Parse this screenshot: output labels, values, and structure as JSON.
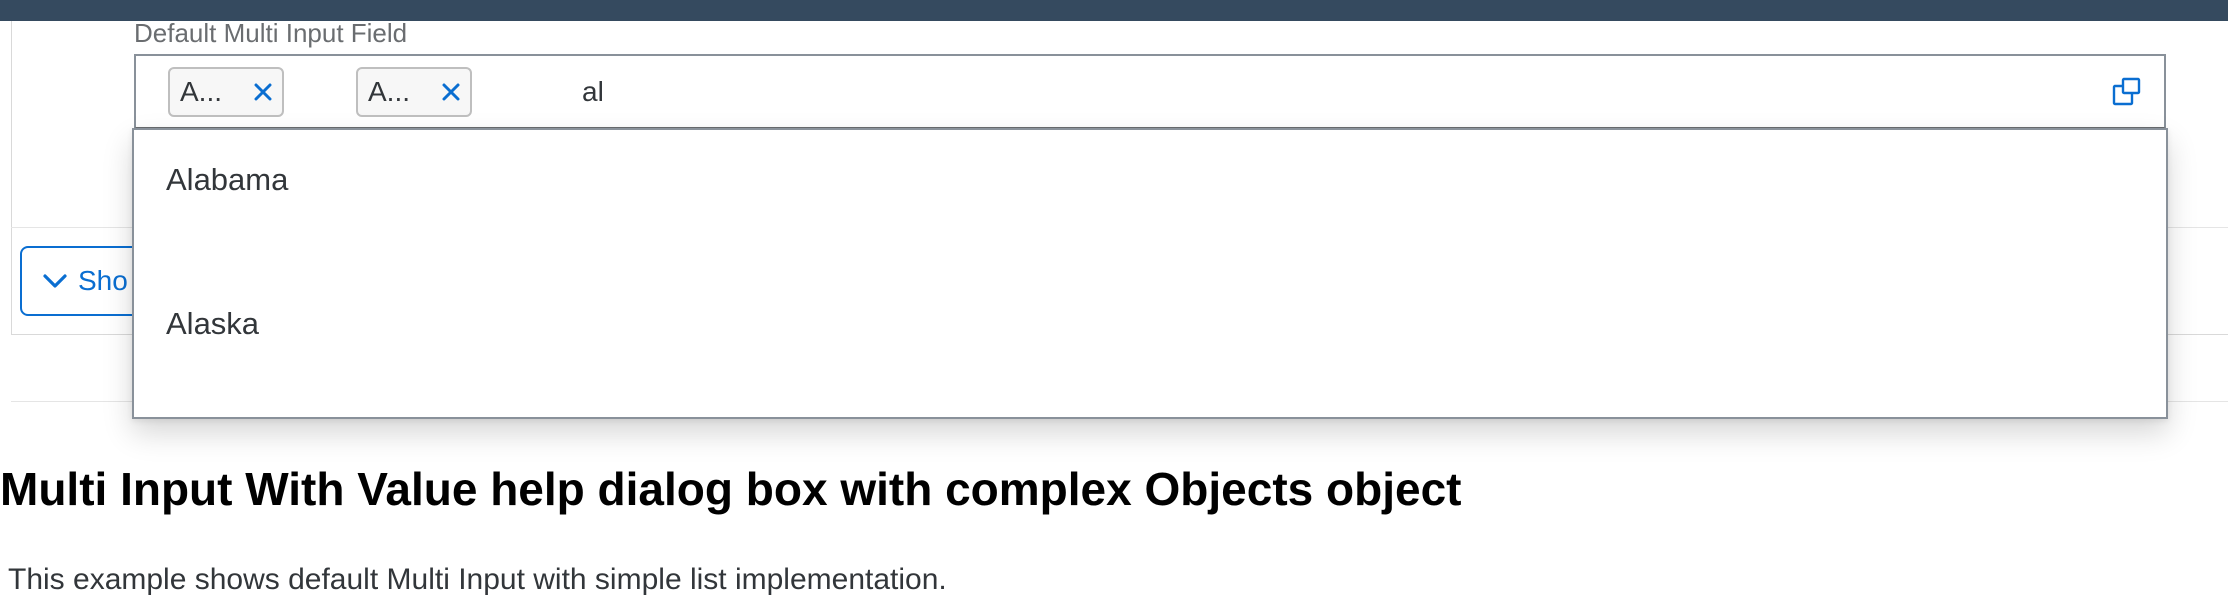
{
  "field": {
    "label": "Default Multi Input Field",
    "tokens": [
      {
        "label": "A..."
      },
      {
        "label": "A..."
      }
    ],
    "input_value": "al",
    "value_help_icon": "value-help-icon"
  },
  "suggestions": [
    {
      "label": "Alabama"
    },
    {
      "label": "Alaska"
    }
  ],
  "show_button": {
    "label": "Sho",
    "icon": "chevron-down-icon"
  },
  "section": {
    "title": "Multi Input With Value help dialog box with complex Objects object",
    "description": "This example shows default Multi Input with simple list implementation."
  },
  "colors": {
    "shell_bar": "#354a5f",
    "accent": "#0a6ed1",
    "text": "#32363a"
  }
}
